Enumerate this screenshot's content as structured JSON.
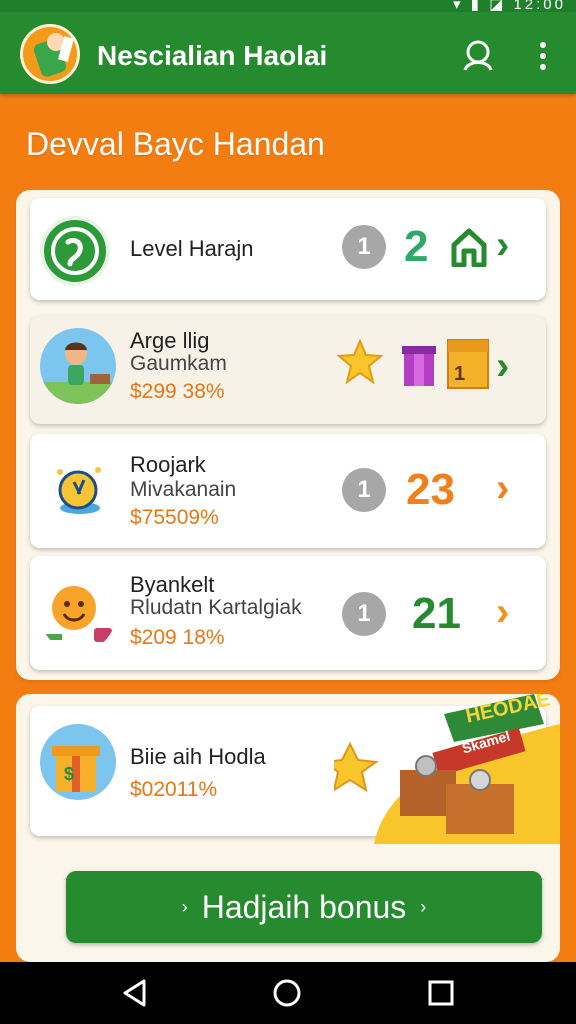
{
  "status_bar": {
    "icons": [
      "wifi-icon",
      "signal-icon",
      "battery-icon",
      "sim-icon"
    ],
    "clock": "12:00"
  },
  "app": {
    "title": "Nescialian Haolai",
    "header_icon": "user-icon",
    "menu_icon": "more-vertical-icon"
  },
  "section": {
    "title": "Devval Bayc Handan"
  },
  "items": [
    {
      "title": "Level Harajn",
      "subtitle": "",
      "amount": "",
      "rank": "1",
      "value_label": "2",
      "extra_icon": "house-icon",
      "value_color": "#2fa86a"
    },
    {
      "title": "Arge llig",
      "subtitle": "Gaumkam",
      "amount": "$299 38%",
      "rank": "",
      "value_label": "",
      "extra_icon": "calendar-icon",
      "value_color": "#268a2f"
    },
    {
      "title": "Roojark",
      "subtitle": "Mivakanain",
      "amount": "$75509%",
      "rank": "1",
      "value_label": "23",
      "extra_icon": "",
      "value_color": "#f07f1c"
    },
    {
      "title": "Byankelt",
      "subtitle": "Rludatn Kartalgiak",
      "amount": "$209 18%",
      "rank": "1",
      "value_label": "21",
      "extra_icon": "",
      "value_color": "#268a2f"
    }
  ],
  "bonus": {
    "title": "Biie aih Hodla",
    "amount": "$02011%",
    "sign_text": "HEODAE",
    "sign2_text": "Skamel"
  },
  "cta": {
    "label": "Hadjaih bonus"
  },
  "colors": {
    "primary": "#268a2f",
    "background": "#f47d12",
    "accent": "#e67714"
  },
  "nav": [
    "back-icon",
    "home-icon",
    "recents-icon"
  ]
}
